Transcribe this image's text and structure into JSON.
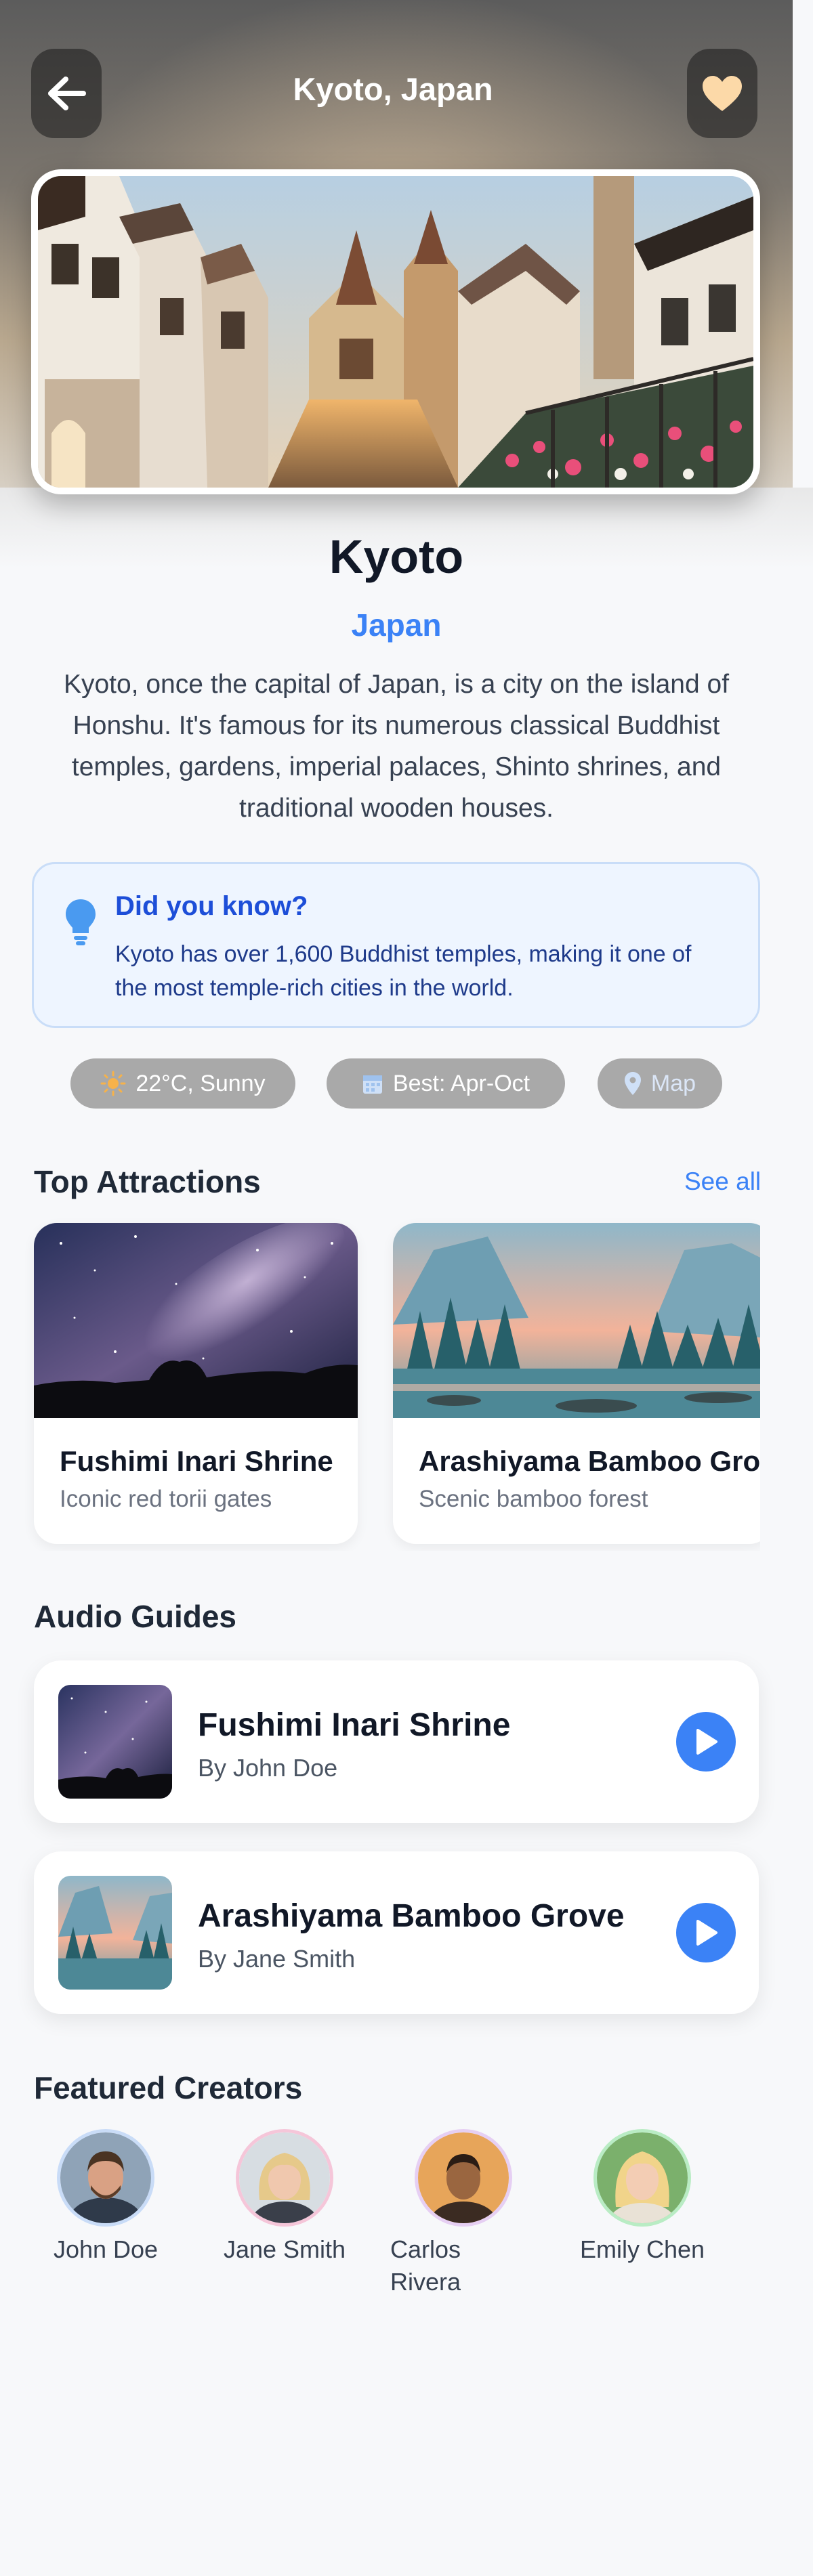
{
  "header": {
    "title": "Kyoto, Japan",
    "back_icon": "arrow-left-icon",
    "favorite_icon": "heart-icon"
  },
  "city": {
    "name": "Kyoto",
    "country": "Japan",
    "description": "Kyoto, once the capital of Japan, is a city on the island of Honshu. It's famous for its numerous classical Buddhist temples, gardens, imperial palaces, Shinto shrines, and traditional wooden houses."
  },
  "fact": {
    "title": "Did you know?",
    "text": "Kyoto has over 1,600 Buddhist temples, making it one of the most temple-rich cities in the world.",
    "icon": "lightbulb-icon"
  },
  "info_pills": {
    "weather": "22°C, Sunny",
    "best_time": "Best: Apr-Oct",
    "map": "Map"
  },
  "attractions": {
    "title": "Top Attractions",
    "see_all": "See all",
    "items": [
      {
        "name": "Fushimi Inari Shrine",
        "subtitle": "Iconic red torii gates"
      },
      {
        "name": "Arashiyama Bamboo Grove",
        "subtitle": "Scenic bamboo forest"
      }
    ]
  },
  "audio_guides": {
    "title": "Audio Guides",
    "items": [
      {
        "title": "Fushimi Inari Shrine",
        "author": "By John Doe"
      },
      {
        "title": "Arashiyama Bamboo Grove",
        "author": "By Jane Smith"
      }
    ]
  },
  "creators": {
    "title": "Featured Creators",
    "items": [
      {
        "name": "John Doe",
        "ring_color": "#c9dcf7"
      },
      {
        "name": "Jane Smith",
        "ring_color": "#f5c6d9"
      },
      {
        "name": "Carlos Rivera",
        "ring_color": "#e6cff3"
      },
      {
        "name": "Emily Chen",
        "ring_color": "#b9ecc4"
      }
    ]
  },
  "colors": {
    "accent": "#3b82f6",
    "background": "#f7f8fa",
    "fact_background": "#eef5ff",
    "heart": "#fcd9a8"
  }
}
